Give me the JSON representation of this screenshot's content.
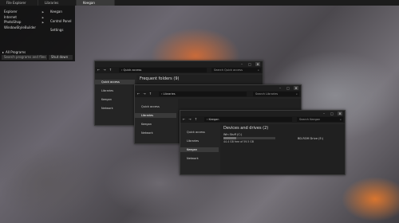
{
  "taskbar": {
    "items": [
      "File Explorer",
      "Libraries",
      "Keegan"
    ],
    "active_index": 2
  },
  "start_menu": {
    "left_items": [
      "Explorer",
      "Internet",
      "PhotoShop",
      "WindowStyleBuilder"
    ],
    "left_has_arrow": [
      true,
      true,
      true,
      false
    ],
    "right_items": [
      "Keegan",
      "Control Panel",
      "Settings"
    ],
    "all_programs": "All Programs",
    "search_placeholder": "Search programs and files",
    "shutdown_label": "Shut down"
  },
  "window1": {
    "address": "Quick access",
    "search": "Search Quick access",
    "sidebar": [
      "Quick access",
      "Libraries",
      "Keegan",
      "Network"
    ],
    "selected_index": 0,
    "heading": "Frequent folders (9)"
  },
  "window2": {
    "address": "Libraries",
    "search": "Search Libraries",
    "sidebar": [
      "Quick access",
      "Libraries",
      "Keegan",
      "Network"
    ],
    "selected_index": 1
  },
  "window3": {
    "address": "Keegan",
    "search": "Search Keegan",
    "sidebar": [
      "Quick access",
      "Libraries",
      "Keegan",
      "Network"
    ],
    "selected_index": 2,
    "heading": "Devices and drives (2)",
    "drives": [
      {
        "name": "Win Stuff (C:)",
        "free": "44.4 GB free of 59.5 GB",
        "used_fraction": 0.25
      },
      {
        "name": "BD-ROM Drive (E:)"
      }
    ]
  }
}
